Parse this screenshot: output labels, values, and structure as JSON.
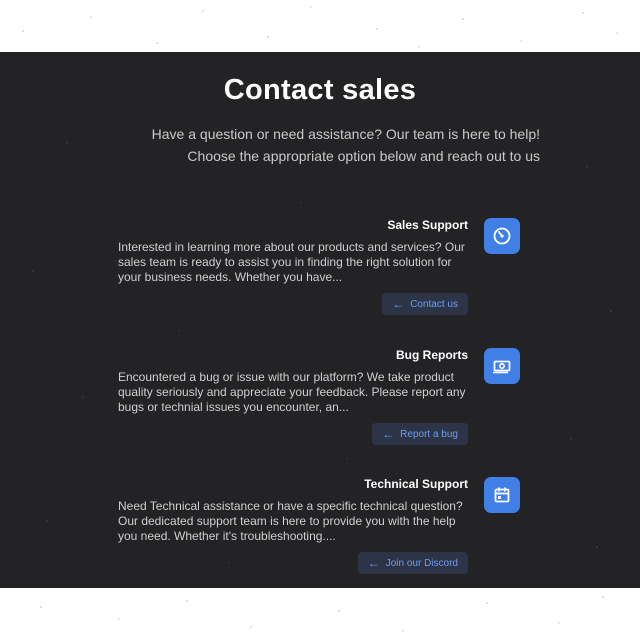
{
  "page": {
    "title": "Contact sales",
    "intro": "Have a question or need assistance? Our team is here to help! Choose the appropriate option below and reach out to us"
  },
  "cards": [
    {
      "title": "Sales Support",
      "description": "Interested in learning more about our products and services? Our sales team is ready to assist you in finding the right solution for your business needs. Whether you have...",
      "button_label": "Contact us",
      "icon": "gauge-icon"
    },
    {
      "title": "Bug Reports",
      "description": "Encountered a bug or issue with our platform? We take product quality seriously and appreciate your feedback. Please report any bugs or technial issues you encounter, an...",
      "button_label": "Report a bug",
      "icon": "money-icon"
    },
    {
      "title": "Technical Support",
      "description": "Need Technical assistance or have a specific technical question? Our dedicated support team is here to provide you with the help you need. Whether it's troubleshooting....",
      "button_label": "Join our Discord",
      "icon": "calendar-icon"
    }
  ],
  "colors": {
    "background": "#232325",
    "accent": "#3f7fe6",
    "button_bg": "#2e3447",
    "button_text": "#6e9cf0"
  }
}
